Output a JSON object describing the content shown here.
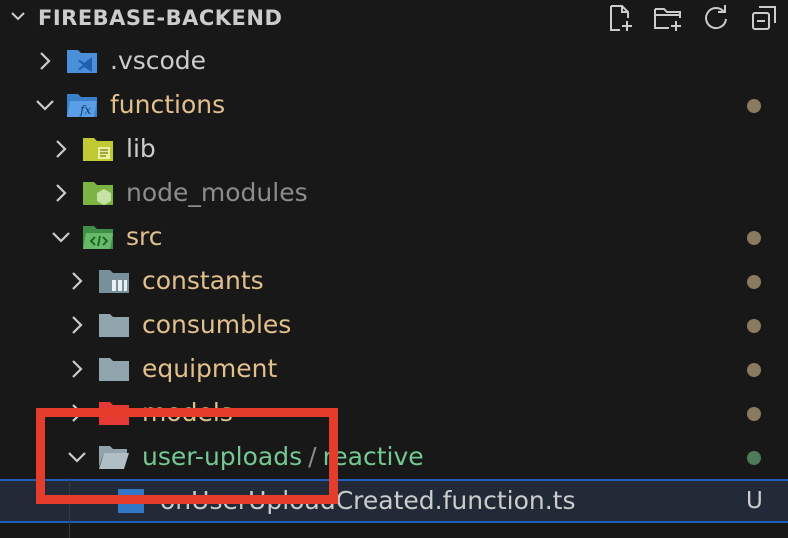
{
  "explorer": {
    "title": "FIREBASE-BACKEND",
    "actions": [
      {
        "icon": "new-file-icon"
      },
      {
        "icon": "new-folder-icon"
      },
      {
        "icon": "refresh-icon"
      },
      {
        "icon": "collapse-all-icon"
      }
    ]
  },
  "colors": {
    "folder_modified": "#e2c08d",
    "untracked": "#73c991",
    "default_text": "#cccccc",
    "ignored_text": "#8c8c8c",
    "modified_dot": "#8a7a60",
    "untracked_dot": "#4f7a5a",
    "highlight_box": "#e53d2c"
  },
  "tree": [
    {
      "label": ".vscode",
      "expanded": false,
      "icon": "vscode-folder-icon"
    },
    {
      "label": "functions",
      "expanded": true,
      "icon": "functions-folder-icon",
      "decoration": "modified"
    },
    {
      "label": "lib",
      "expanded": false,
      "icon": "lib-folder-icon"
    },
    {
      "label": "node_modules",
      "expanded": false,
      "icon": "node-folder-icon"
    },
    {
      "label": "src",
      "expanded": true,
      "icon": "src-folder-icon",
      "decoration": "modified"
    },
    {
      "label": "constants",
      "expanded": false,
      "icon": "constants-folder-icon",
      "decoration": "modified"
    },
    {
      "label": "consumbles",
      "expanded": false,
      "icon": "folder-icon",
      "decoration": "modified"
    },
    {
      "label": "equipment",
      "expanded": false,
      "icon": "folder-icon",
      "decoration": "modified"
    },
    {
      "label": "models",
      "expanded": false,
      "icon": "models-folder-icon",
      "decoration": "modified"
    },
    {
      "label_primary": "user-uploads",
      "separator": "/",
      "label_secondary": "reactive",
      "expanded": true,
      "icon": "folder-open-icon",
      "decoration": "untracked"
    },
    {
      "label": "onUserUploadCreated.function.ts",
      "icon": "typescript-file-icon",
      "status": "U",
      "selected": true
    }
  ]
}
